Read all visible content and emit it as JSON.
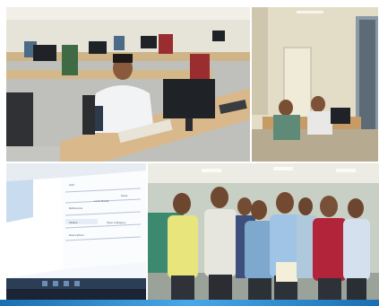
{
  "collage": {
    "photos": [
      {
        "id": "computer-lab-wide"
      },
      {
        "id": "computer-lab-corner"
      },
      {
        "id": "laptop-screen"
      },
      {
        "id": "group-photo"
      }
    ]
  },
  "colors": {
    "frame_band": "#2f8fd6",
    "wall": "#e8e6dc",
    "desk": "#d9b98c",
    "monitor": "#1f2226"
  },
  "laptop_screen": {
    "lines": [
      "Lock Fields",
      "Add",
      "Reference",
      "Save",
      "Status",
      "Type Category",
      "Description"
    ]
  }
}
